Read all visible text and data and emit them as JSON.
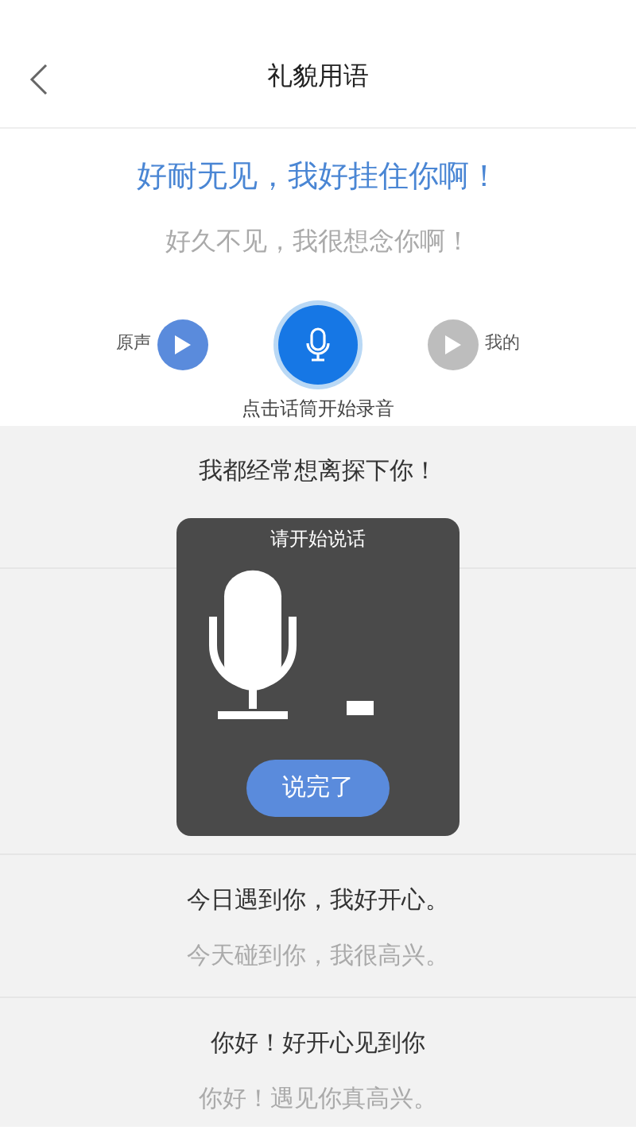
{
  "header": {
    "title": "礼貌用语"
  },
  "current": {
    "cantonese": "好耐无见，我好挂住你啊！",
    "mandarin": "好久不见，我很想念你啊！"
  },
  "players": [
    {
      "label": "原声",
      "enabled": true
    },
    {
      "label": "我的",
      "enabled": false
    }
  ],
  "hint": "点击话筒开始录音",
  "phrases": [
    {
      "cantonese": "我都经常想离探下你！"
    },
    {
      "cantonese": "今日遇到你，我好开心。",
      "mandarin": "今天碰到你，我很高兴。"
    },
    {
      "cantonese": "你好！好开心见到你",
      "mandarin": "你好！遇见你真高兴。"
    }
  ],
  "dialog": {
    "title": "请开始说话",
    "button": "说完了"
  }
}
